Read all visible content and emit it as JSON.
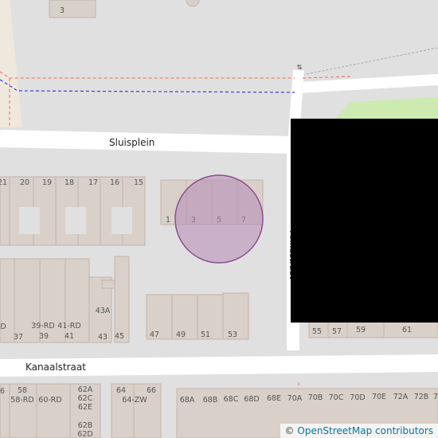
{
  "map": {
    "streets": {
      "sluisplein": "Sluisplein",
      "kanaalstraat": "Kanaalstraat",
      "side_street_partial": "Annastraat"
    },
    "house_numbers": {
      "top": [
        "3"
      ],
      "sluisplein_row": [
        "21",
        "20",
        "19",
        "18",
        "17",
        "16",
        "15"
      ],
      "circle_block": [
        "1",
        "3",
        "5",
        "7"
      ],
      "south_row_upper": [
        "43A"
      ],
      "south_row_lower": [
        "D",
        "37",
        "39-RD",
        "39",
        "41-RD",
        "41",
        "43",
        "45"
      ],
      "east_block": [
        "47",
        "49",
        "51",
        "53"
      ],
      "right_edge": [
        "55",
        "57",
        "59",
        "61"
      ],
      "kanaal_west": [
        "6",
        "58",
        "58-RD",
        "60-RD",
        "62A",
        "62C",
        "62E",
        "62B",
        "62D",
        "64",
        "64-ZW",
        "66"
      ],
      "kanaal_east": [
        "68A",
        "68B",
        "68C",
        "68D",
        "68E",
        "70A",
        "70B",
        "70C",
        "70D",
        "70E",
        "72A",
        "72B",
        "7"
      ]
    },
    "marker": {
      "type": "circle",
      "fill": "#b58bb6",
      "stroke": "#8a4f8c"
    },
    "colors": {
      "background": "#e0e0e0",
      "road": "#ffffff",
      "building": "#d9d0c9",
      "grass": "#cdebb0",
      "path_red": "#f27f6b",
      "path_blue": "#3a3ae0"
    }
  },
  "attribution": {
    "symbol": "©",
    "text": "OpenStreetMap contributors"
  }
}
